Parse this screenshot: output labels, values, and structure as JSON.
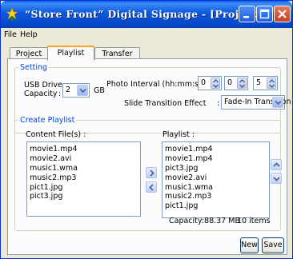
{
  "window": {
    "title": "“Store Front” Digital Signage - [Project.dsg]"
  },
  "menu": [
    "File",
    "Help"
  ],
  "tabs": [
    {
      "label": "Project",
      "active": false
    },
    {
      "label": "Playlist",
      "active": true
    },
    {
      "label": "Transfer",
      "active": false
    }
  ],
  "setting": {
    "legend": "Setting",
    "usb_label_1": "USB Drive",
    "usb_label_2": "Capacity",
    "usb_colon": ":",
    "usb_value": "2",
    "usb_unit": "GB",
    "interval_label": "Photo Interval (hh:mm:ss):",
    "interval_h": "0",
    "interval_m": "0",
    "interval_s": "5",
    "transition_label": "Slide Transition Effect",
    "transition_colon": ":",
    "transition_value": "Fade-In Transition"
  },
  "create": {
    "legend": "Create Playlist",
    "content_label": "Content File(s) :",
    "content_files": [
      "movie1.mp4",
      "movie2.avi",
      "music1.wma",
      "music2.mp3",
      "pict1.jpg",
      "pict3.jpg"
    ],
    "playlist_label": "Playlist :",
    "playlist_items": [
      "movie1.mp4",
      "movie1.mp4",
      "pict3.jpg",
      "movie2.avi",
      "music1.wma",
      "music2.mp3",
      "pict1.jpg"
    ],
    "capacity_text": "Capacity:88.37 MB",
    "items_text": "10 items"
  },
  "buttons": {
    "new": "New",
    "save": "Save"
  },
  "colors": {
    "title_bar": "#0a58e0",
    "legend": "#0046d5",
    "active_tab_accent": "#f5a623"
  }
}
